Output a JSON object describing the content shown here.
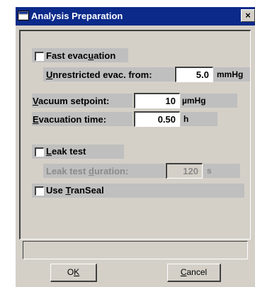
{
  "window": {
    "title": "Analysis Preparation",
    "close": "×"
  },
  "fast_evacuation": {
    "checked": false,
    "label_pre": "Fast evac",
    "label_u": "u",
    "label_post": "ation"
  },
  "unrestricted": {
    "label_pre": "",
    "label_u": "U",
    "label_post": "nrestricted evac. from:",
    "value": "5.0",
    "unit": "mmHg"
  },
  "vacuum_setpoint": {
    "label_u": "V",
    "label_post": "acuum setpoint:",
    "value": "10",
    "unit": "µmHg"
  },
  "evacuation_time": {
    "label_u": "E",
    "label_post": "vacuation time:",
    "value": "0.50",
    "unit": "h"
  },
  "leak_test": {
    "checked": false,
    "label_u": "L",
    "label_post": "eak test"
  },
  "leak_test_duration": {
    "label_pre": "Leak test ",
    "label_u": "d",
    "label_post": "uration:",
    "value": "120",
    "unit": "s"
  },
  "use_transeal": {
    "checked": false,
    "label_pre": "Use ",
    "label_u": "T",
    "label_post": "ranSeal"
  },
  "status_text": "",
  "buttons": {
    "ok_pre": "O",
    "ok_u": "K",
    "cancel_u": "C",
    "cancel_post": "ancel"
  },
  "colors": {
    "titlebar": "#0b2a8a",
    "face": "#d4d0c8",
    "field_bg": "#bfbfbf",
    "disabled_text": "#8a8a8a"
  }
}
